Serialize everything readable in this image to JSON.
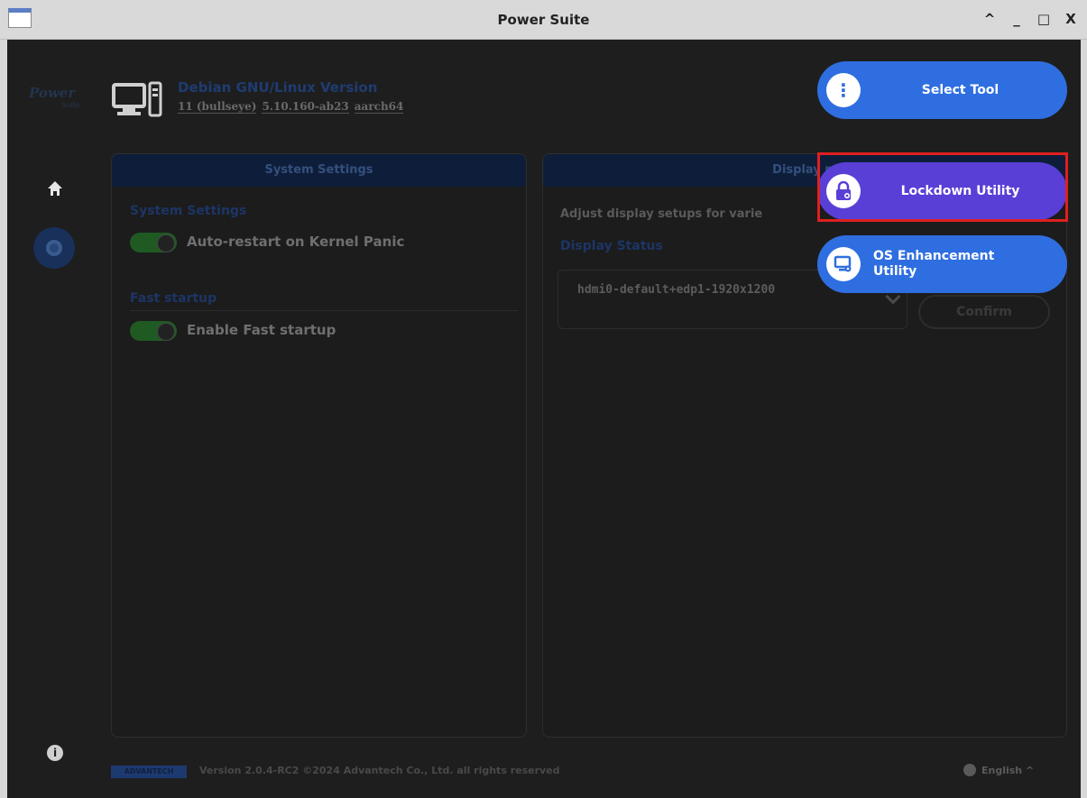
{
  "window": {
    "title": "Power Suite",
    "controls": {
      "collapse": "^",
      "minimize": "_",
      "maximize": "□",
      "close": "X"
    }
  },
  "sidebar": {
    "logo": "Power",
    "logo_sub": "Suite",
    "items": [
      {
        "icon": "home-icon"
      },
      {
        "icon": "gear-icon"
      },
      {
        "icon": "info-icon",
        "glyph": "i"
      }
    ]
  },
  "system_info": {
    "os_name": "Debian GNU/Linux Version",
    "version": "11 (bullseye)",
    "kernel": "5.10.160-ab23",
    "arch": "aarch64"
  },
  "left_panel": {
    "header": "System Settings",
    "section1_title": "System Settings",
    "option1": "Auto-restart on Kernel Panic",
    "section2_title": "Fast startup",
    "option2": "Enable Fast startup"
  },
  "right_panel": {
    "header": "Display m",
    "description": "Adjust display setups for varie",
    "status_title": "Display Status",
    "select_value": "hdmi0-default+edp1-1920x1200",
    "confirm": "Confirm"
  },
  "footer": {
    "brand": "ADVANTECH",
    "version": "Version 2.0.4-RC2 ©2024 Advantech Co., Ltd. all rights reserved",
    "language": "English ^"
  },
  "tools": {
    "select_tool": "Select Tool",
    "select_tool_glyph": "⋮",
    "lockdown": "Lockdown Utility",
    "os_enhancement_line1": "OS Enhancement",
    "os_enhancement_line2": "Utility"
  },
  "colors": {
    "primary_blue": "#2f6ee0",
    "lockdown_purple": "#5a3fd6",
    "highlight_red": "#e01f1f",
    "toggle_green": "#1f5a23"
  }
}
